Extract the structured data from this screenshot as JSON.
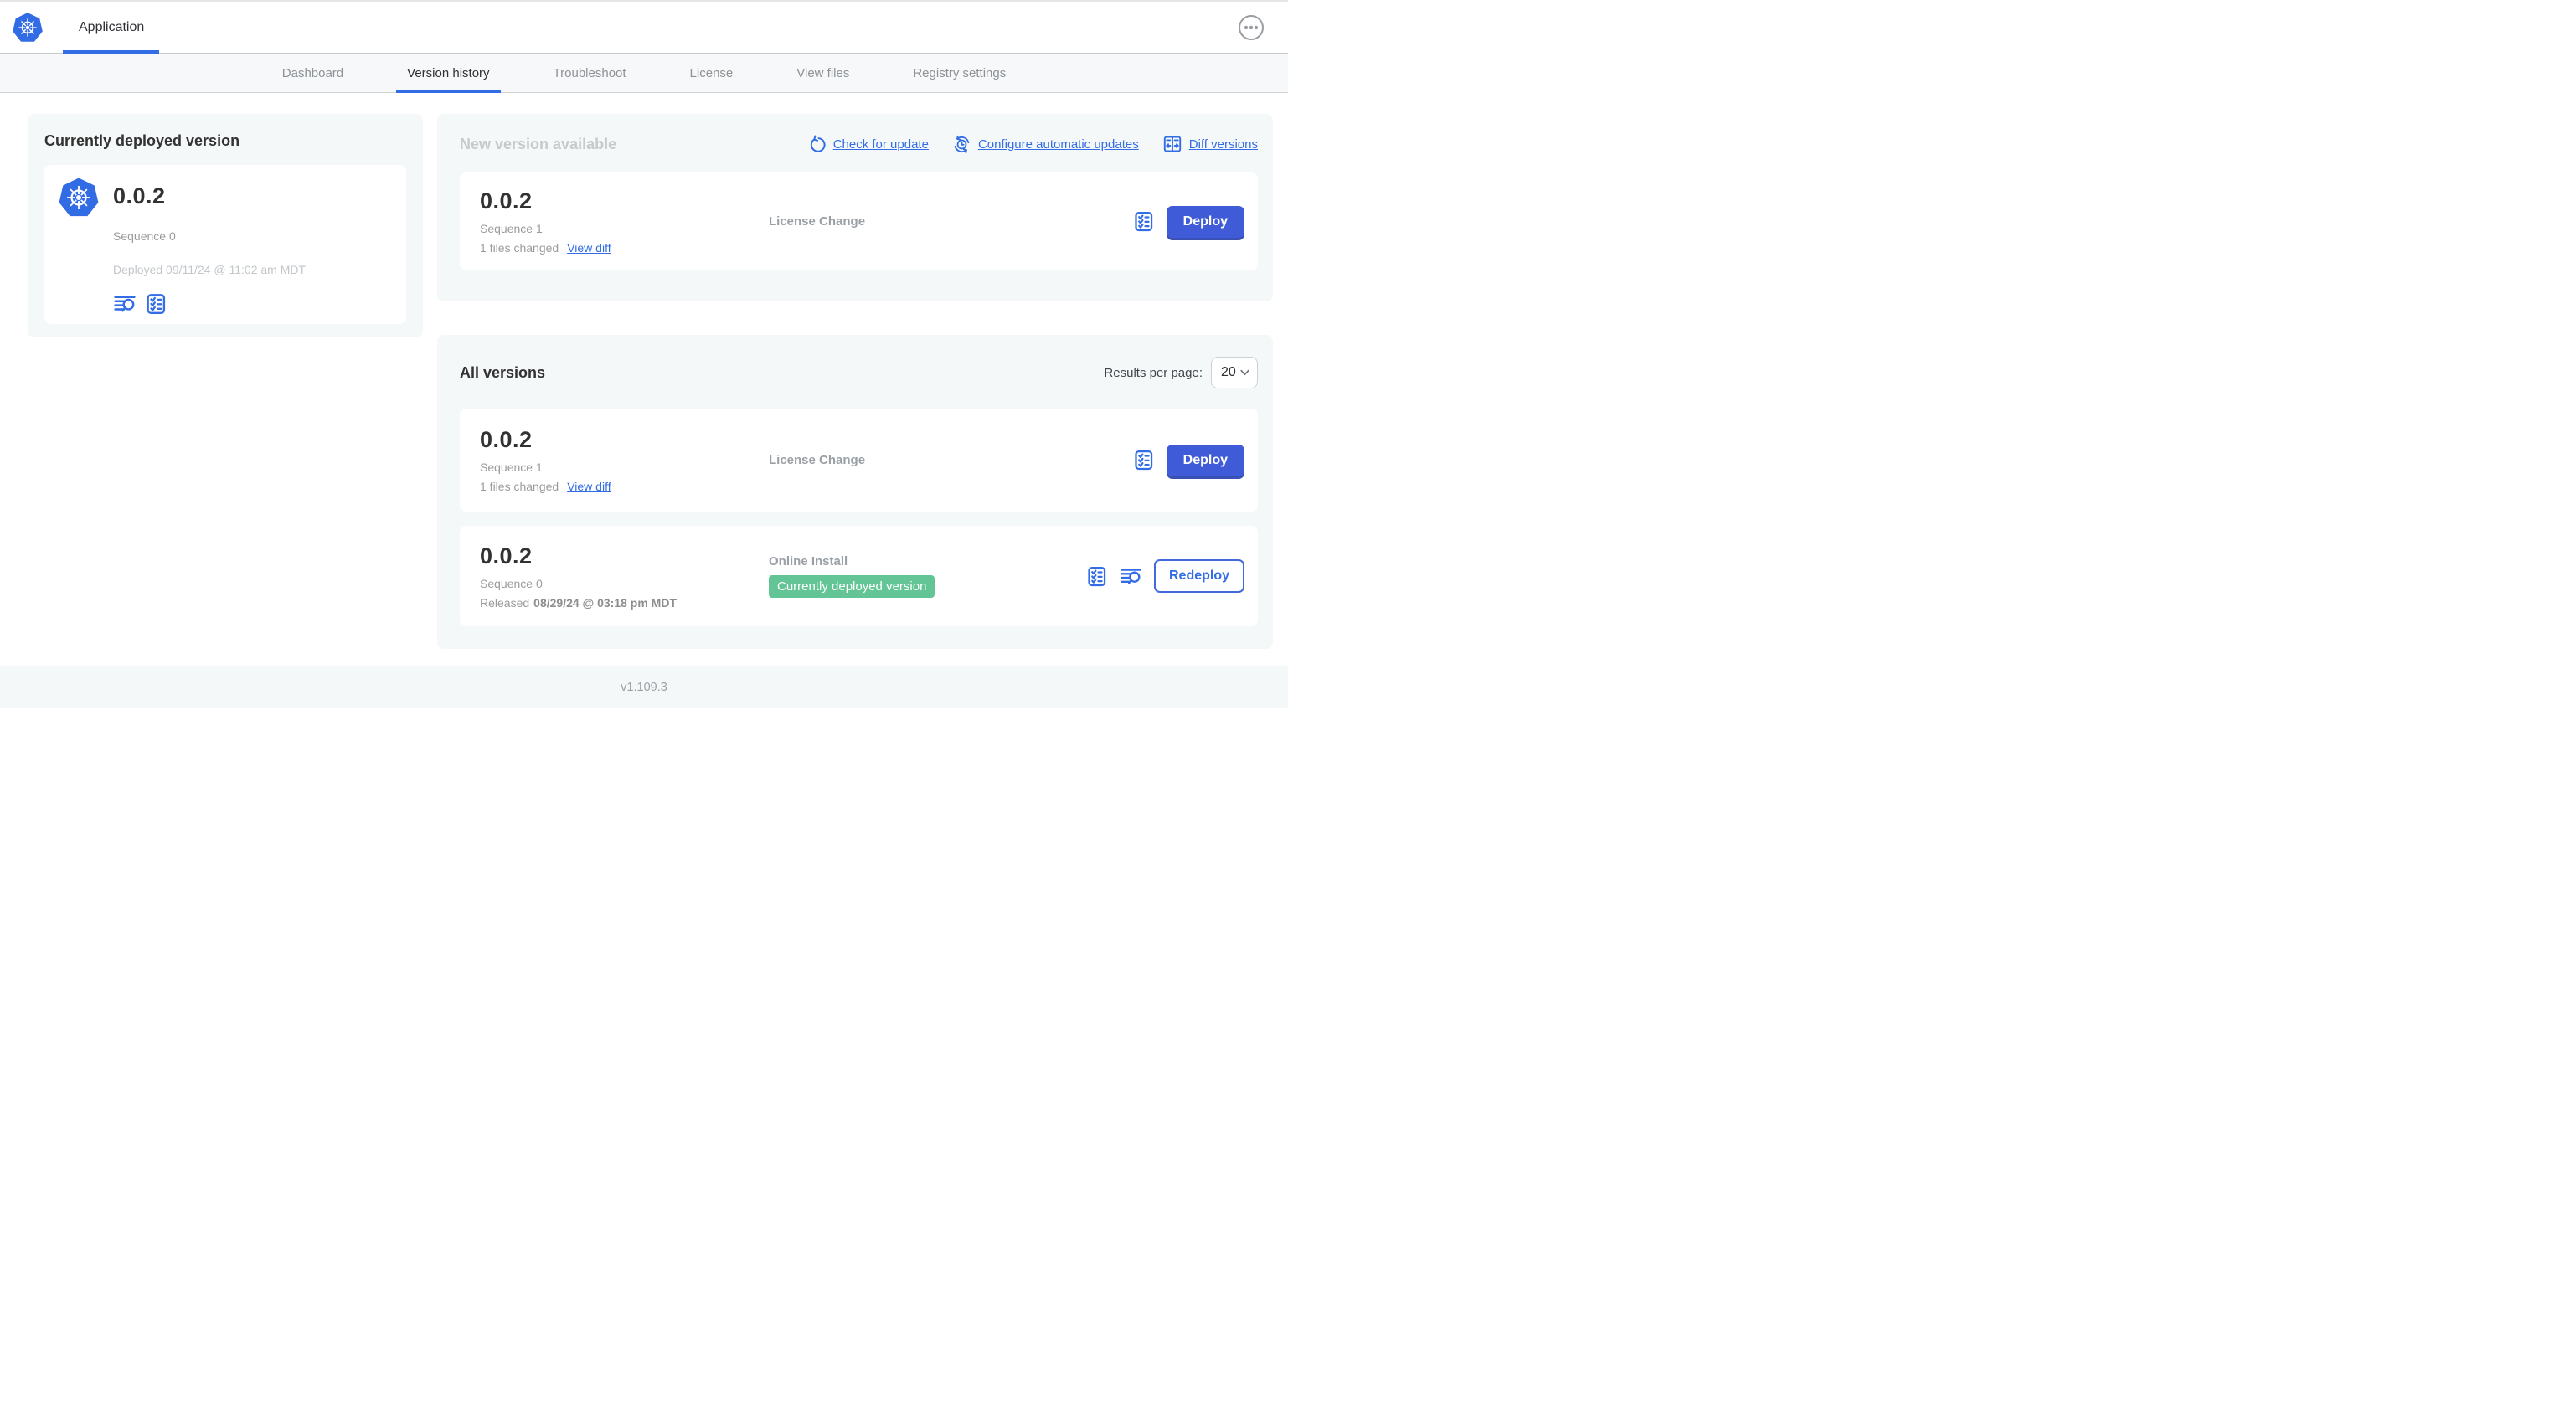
{
  "navbar": {
    "title": "Application"
  },
  "subnav": {
    "tabs": [
      {
        "label": "Dashboard",
        "active": false
      },
      {
        "label": "Version history",
        "active": true
      },
      {
        "label": "Troubleshoot",
        "active": false
      },
      {
        "label": "License",
        "active": false
      },
      {
        "label": "View files",
        "active": false
      },
      {
        "label": "Registry settings",
        "active": false
      }
    ]
  },
  "currently_deployed": {
    "title": "Currently deployed version",
    "version": "0.0.2",
    "sequence": "Sequence 0",
    "deployed": "Deployed 09/11/24 @ 11:02 am MDT",
    "icons": [
      "logs-icon",
      "checklist-icon"
    ]
  },
  "new_version": {
    "title": "New version available",
    "links": [
      {
        "label": "Check for update",
        "icon": "refresh-icon"
      },
      {
        "label": "Configure automatic updates",
        "icon": "schedule-sync-icon"
      },
      {
        "label": "Diff versions",
        "icon": "diff-icon"
      }
    ],
    "card": {
      "version": "0.0.2",
      "sequence": "Sequence 1",
      "files_changed": "1 files changed",
      "view_diff": "View diff",
      "source": "License Change",
      "action": "Deploy",
      "icons": [
        "checklist-icon"
      ]
    }
  },
  "all_versions": {
    "title": "All versions",
    "results_per_page_label": "Results per page:",
    "results_per_page": "20",
    "rows": [
      {
        "version": "0.0.2",
        "sequence": "Sequence 1",
        "files_changed": "1 files changed",
        "view_diff": "View diff",
        "source": "License Change",
        "action": "Deploy",
        "icons": [
          "checklist-icon"
        ]
      },
      {
        "version": "0.0.2",
        "sequence": "Sequence 0",
        "released_prefix": "Released",
        "released_date": "08/29/24 @ 03:18 pm MDT",
        "source": "Online Install",
        "badge": "Currently deployed version",
        "action": "Redeploy",
        "icons": [
          "checklist-icon",
          "logs-icon"
        ]
      }
    ]
  },
  "footer": {
    "version_label": "v1.109.3"
  },
  "icons": {
    "navbar_logo": "kubernetes-logo",
    "overflow_menu": "ellipsis-circle",
    "select_caret": "chevron-down"
  },
  "colors": {
    "accent_blue": "#326de6",
    "button_blue": "#3f5bd8",
    "button_blue_shadow": "#3950b4",
    "badge_green": "#63c596",
    "panel_background": "#f5f8f9",
    "subnav_background": "#f6f8f9",
    "text_dark": "#323232",
    "text_gray": "#9b9b9b",
    "text_muted": "#c7cacd"
  }
}
